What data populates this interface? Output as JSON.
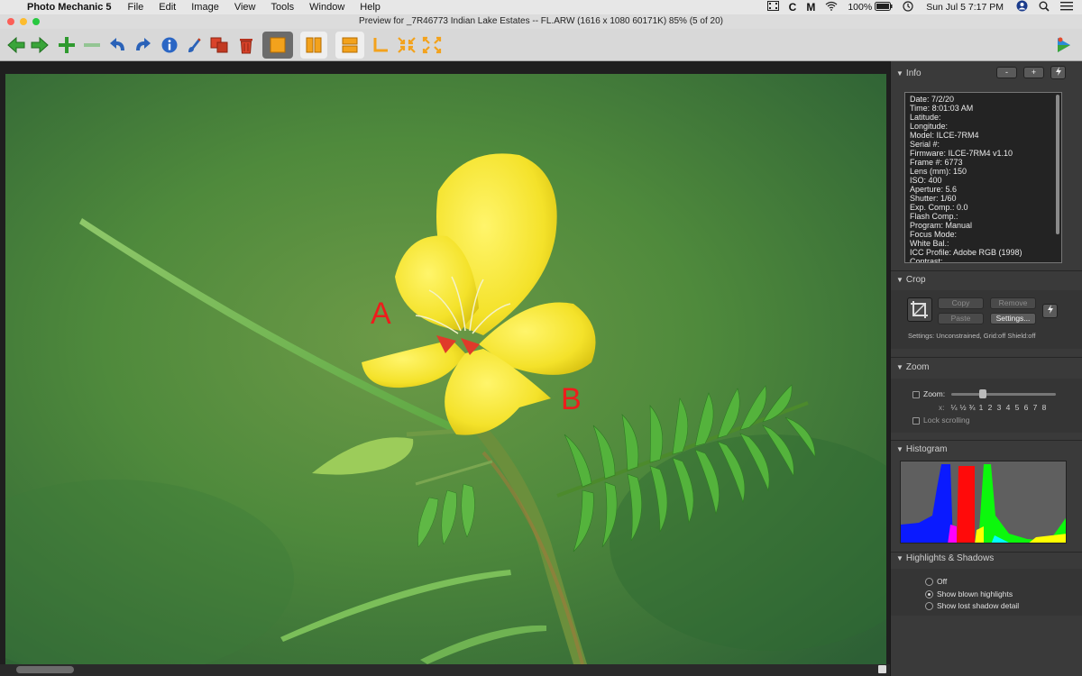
{
  "menubar": {
    "app_name": "Photo Mechanic 5",
    "items": [
      "File",
      "Edit",
      "Image",
      "View",
      "Tools",
      "Window",
      "Help"
    ],
    "battery": "100%",
    "datetime": "Sun Jul 5  7:17 PM"
  },
  "window": {
    "title": "Preview for _7R46773 Indian Lake Estates -- FL.ARW (1616 x 1080 60171K) 85% (5 of 20)"
  },
  "image": {
    "annotation_a": "A",
    "annotation_b": "B"
  },
  "panel": {
    "info": {
      "title": "Info",
      "minus_label": "-",
      "plus_label": "+",
      "lines": [
        "Date: 7/2/20",
        "Time: 8:01:03 AM",
        "Latitude:",
        "Longitude:",
        "Model: ILCE-7RM4",
        "Serial #:",
        "Firmware: ILCE-7RM4 v1.10",
        "Frame #: 6773",
        "Lens (mm): 150",
        "ISO: 400",
        "Aperture: 5.6",
        "Shutter: 1/60",
        "Exp. Comp.: 0.0",
        "Flash Comp.:",
        "Program: Manual",
        "Focus Mode:",
        "White Bal.:",
        "ICC Profile: Adobe RGB (1998)",
        "Contrast:"
      ]
    },
    "crop": {
      "title": "Crop",
      "copy": "Copy",
      "remove": "Remove",
      "paste": "Paste",
      "settings_button": "Settings...",
      "settings_text": "Settings:    Unconstrained, Grid:off Shield:off"
    },
    "zoom": {
      "title": "Zoom",
      "zoom_label": "Zoom:",
      "x_label": "x:",
      "levels": [
        "¼",
        "½",
        "¾",
        "1",
        "2",
        "3",
        "4",
        "5",
        "6",
        "7",
        "8"
      ],
      "lock_label": "Lock scrolling"
    },
    "histogram": {
      "title": "Histogram"
    },
    "highlights": {
      "title": "Highlights & Shadows",
      "options": [
        "Off",
        "Show blown highlights",
        "Show lost shadow detail"
      ],
      "selected": "Show blown highlights"
    }
  }
}
